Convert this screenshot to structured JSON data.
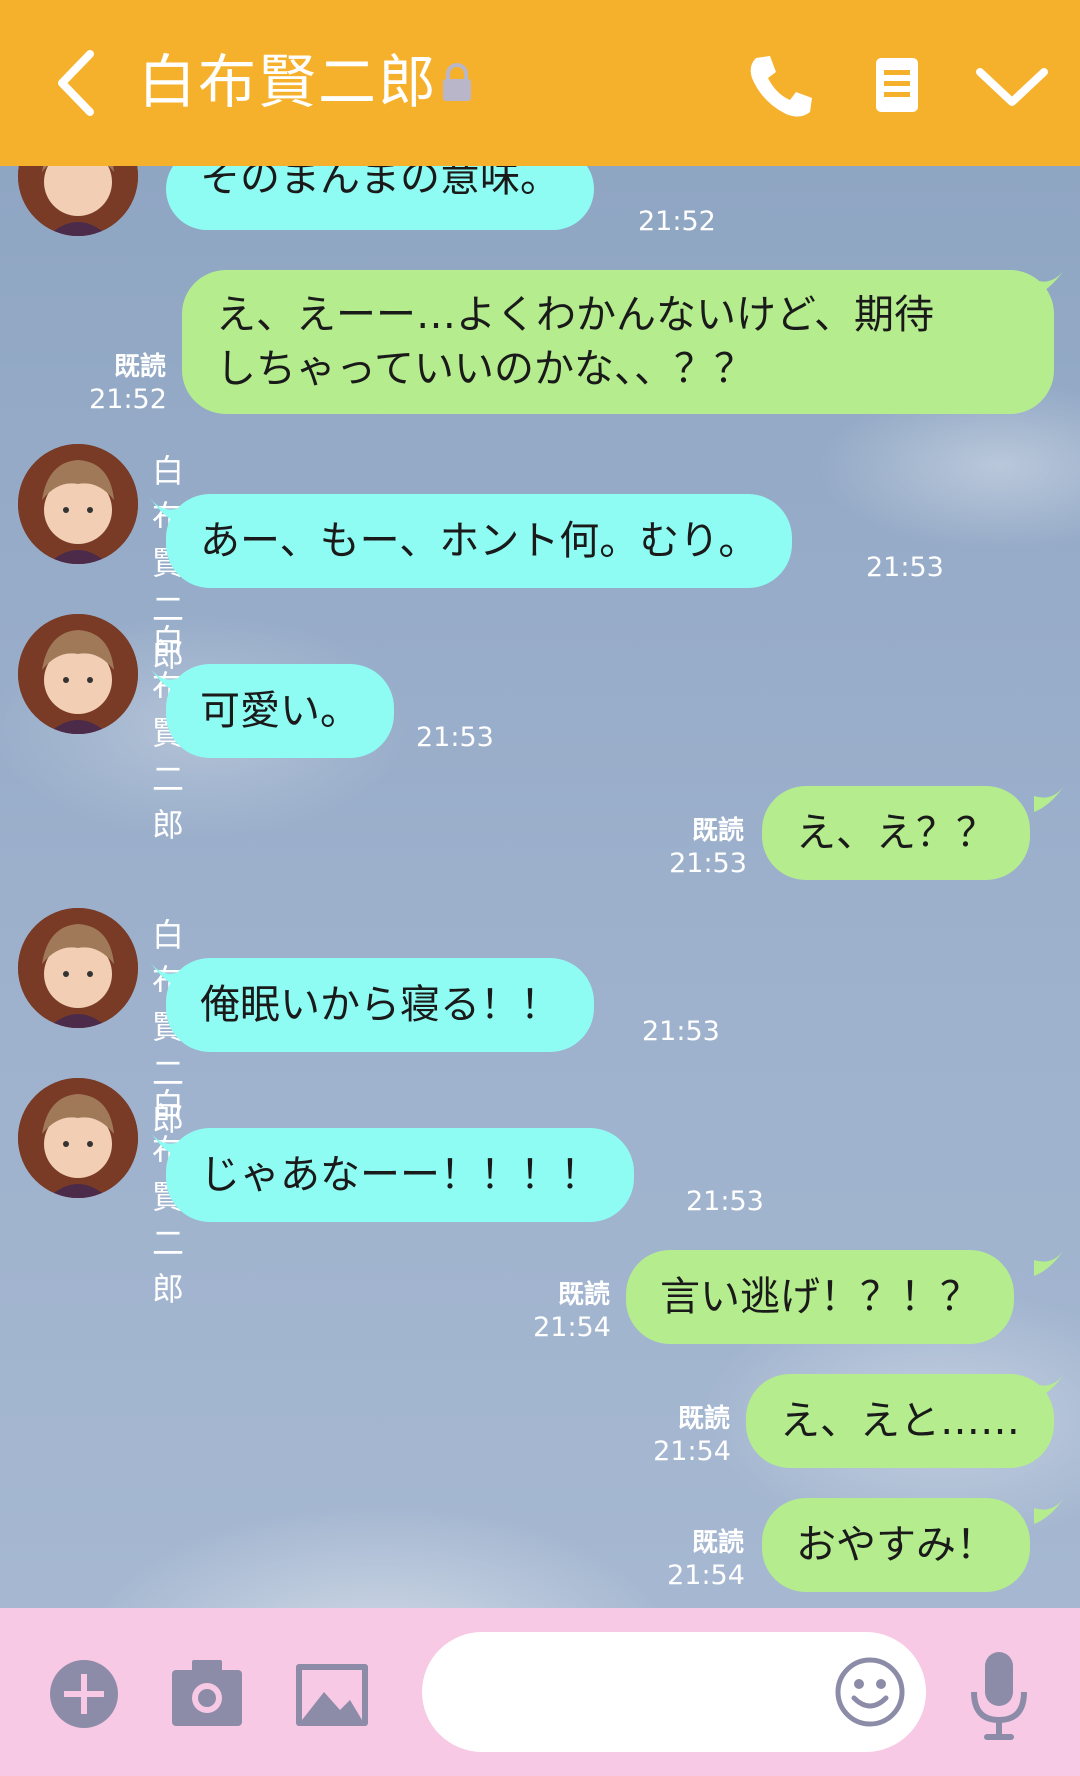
{
  "header": {
    "contact_name": "白布賢二郎",
    "background": "#f6b12c",
    "icons": [
      "back-chevron-icon",
      "lock-icon",
      "phone-icon",
      "notes-icon",
      "chevron-down-icon"
    ]
  },
  "messages": [
    {
      "side": "in",
      "sender": "",
      "text": "そのまんまの意味。",
      "time": "21:52"
    },
    {
      "side": "out",
      "read": "既読",
      "text": [
        "え、えーー…よくわかんないけど、期待",
        "しちゃっていいのかな、、？？"
      ],
      "time": "21:52"
    },
    {
      "side": "in",
      "sender": "白布賢二郎",
      "text": "あー、もー、ホント何。むり。",
      "time": "21:53"
    },
    {
      "side": "in",
      "sender": "白布賢二郎",
      "text": "可愛い。",
      "time": "21:53"
    },
    {
      "side": "out",
      "read": "既読",
      "text": "え、え？？",
      "time": "21:53"
    },
    {
      "side": "in",
      "sender": "白布賢二郎",
      "text": "俺眠いから寝る！！",
      "time": "21:53"
    },
    {
      "side": "in",
      "sender": "白布賢二郎",
      "text": "じゃあなーー！！！！",
      "time": "21:53"
    },
    {
      "side": "out",
      "read": "既読",
      "text": "言い逃げ！？！？",
      "time": "21:54"
    },
    {
      "side": "out",
      "read": "既読",
      "text": "え、えと……",
      "time": "21:54"
    },
    {
      "side": "out",
      "read": "既読",
      "text": "おやすみ！",
      "time": "21:54"
    }
  ],
  "footer": {
    "background": "#f7c9e4",
    "input_value": "",
    "icons": [
      "add-icon",
      "camera-icon",
      "image-icon",
      "emoji-icon",
      "microphone-icon"
    ]
  },
  "colors": {
    "incoming_bubble": "#8ffcf3",
    "outgoing_bubble": "#b5ed8e",
    "icon_gray": "#8c8ca8"
  }
}
